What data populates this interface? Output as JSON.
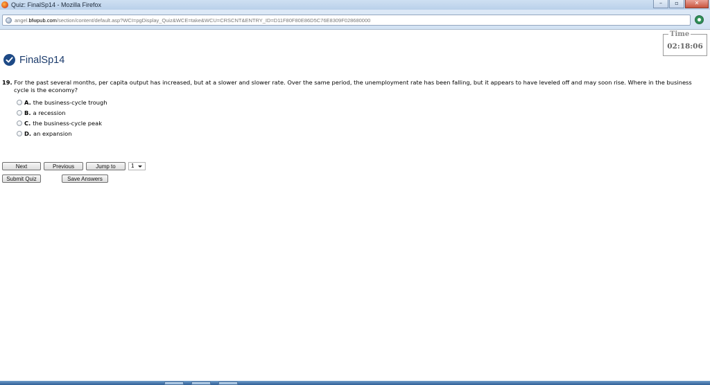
{
  "window": {
    "title": "Quiz: FinalSp14 - Mozilla Firefox",
    "minimize_glyph": "–",
    "maximize_glyph": "▫",
    "close_glyph": "✕"
  },
  "address_bar": {
    "url_prefix": "angel.",
    "url_domain": "bfwpub.com",
    "url_path": "/section/content/default.asp?WCI=pgDisplay_Quiz&WCE=take&WCU=CRSCNT&ENTRY_ID=D11F80F80E86D5C76E8309F028680000"
  },
  "timer": {
    "label": "Time",
    "value": "02:18:06"
  },
  "quiz": {
    "title": "FinalSp14"
  },
  "question": {
    "number": "19.",
    "text_line1": "For the past several months, per capita output has increased, but at a slower and slower rate. Over the same period, the unemployment rate has been falling, but it appears to have leveled off and may soon rise. Where in the business",
    "text_line2": "cycle is the economy?",
    "choices": [
      {
        "letter": "A.",
        "text": "the business-cycle trough"
      },
      {
        "letter": "B.",
        "text": "a recession"
      },
      {
        "letter": "C.",
        "text": "the business-cycle peak"
      },
      {
        "letter": "D.",
        "text": "an expansion"
      }
    ]
  },
  "navigation": {
    "next_label": "Next",
    "previous_label": "Previous",
    "jump_label": "Jump to",
    "jump_value": "1",
    "submit_label": "Submit Quiz",
    "save_label": "Save Answers"
  }
}
